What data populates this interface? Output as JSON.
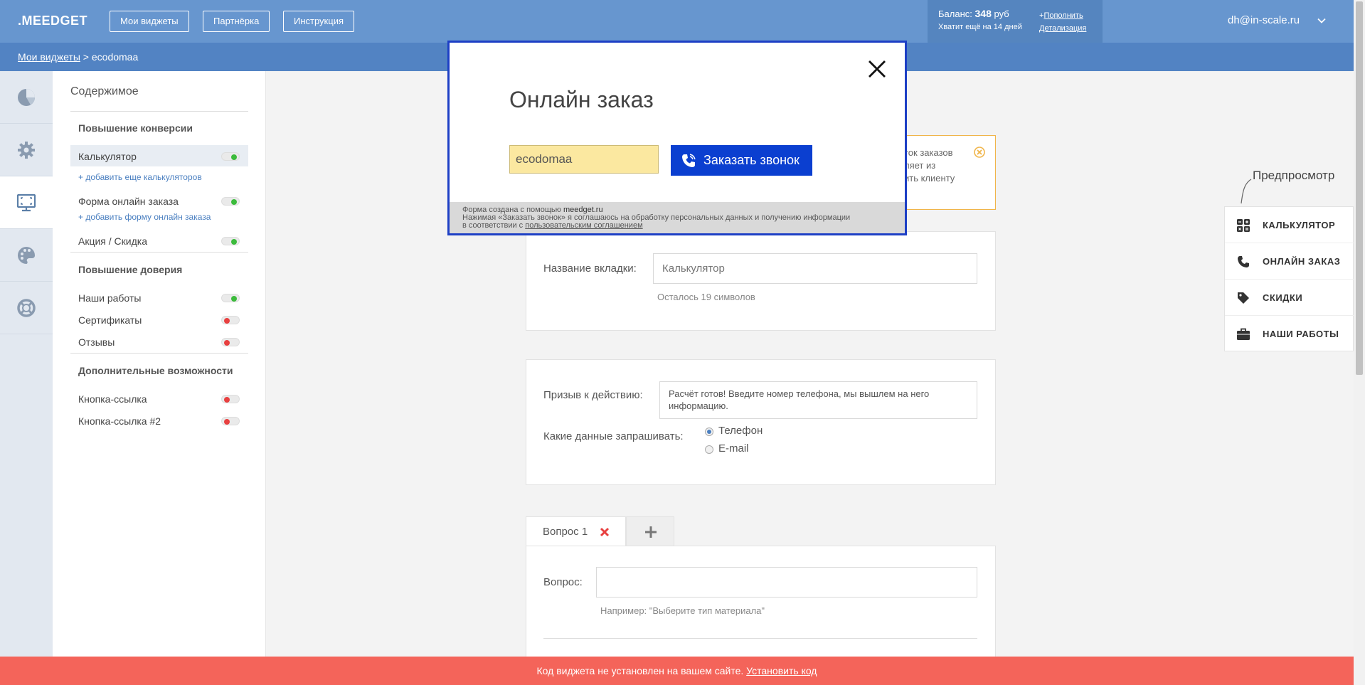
{
  "header": {
    "logo": ".MEEDGET",
    "nav": [
      "Мои виджеты",
      "Партнёрка",
      "Инструкция"
    ],
    "balance_label": "Баланс:",
    "balance_value": "348",
    "balance_currency": "руб",
    "balance_days": "Хватит ещё на 14 дней",
    "topup_plus": "+",
    "topup_label": "Пополнить",
    "details_label": "Детализация",
    "user_email": "dh@in-scale.ru"
  },
  "breadcrumb": {
    "root": "Мои виджеты",
    "sep": " > ",
    "current": "ecodomaa"
  },
  "sidebar": {
    "title": "Содержимое",
    "sections": [
      {
        "title": "Повышение конверсии",
        "items": [
          {
            "label": "Калькулятор",
            "on": true,
            "selected": true,
            "add": "+ добавить еще калькуляторов"
          },
          {
            "label": "Форма онлайн заказа",
            "on": true,
            "selected": false,
            "add": "+ добавить форму онлайн заказа"
          },
          {
            "label": "Акция / Скидка",
            "on": true,
            "selected": false,
            "add": ""
          }
        ]
      },
      {
        "title": "Повышение доверия",
        "items": [
          {
            "label": "Наши работы",
            "on": true
          },
          {
            "label": "Сертификаты",
            "on": false
          },
          {
            "label": "Отзывы",
            "on": false
          }
        ]
      },
      {
        "title": "Дополнительные возможности",
        "items": [
          {
            "label": "Кнопка-ссылка",
            "on": false
          },
          {
            "label": "Кнопка-ссылка #2",
            "on": false
          }
        ]
      }
    ]
  },
  "notice": {
    "line1": "ток заказов",
    "line2": "ляет из",
    "line3": "ить клиенту"
  },
  "tab_name": {
    "label": "Название вкладки:",
    "placeholder": "Калькулятор",
    "hint": "Осталось 19 символов"
  },
  "cta": {
    "label": "Призыв к действию:",
    "value": "Расчёт готов! Введите номер телефона, мы вышлем на него информацию.",
    "request_label": "Какие данные запрашивать:",
    "options": [
      "Телефон",
      "E-mail"
    ],
    "selected": "Телефон"
  },
  "questions": {
    "tab_label": "Вопрос 1",
    "question_label": "Вопрос:",
    "question_value": "",
    "hint": "Например: \"Выберите тип материала\""
  },
  "preview": {
    "title": "Предпросмотр",
    "items": [
      "КАЛЬКУЛЯТОР",
      "ОНЛАЙН ЗАКАЗ",
      "СКИДКИ",
      "НАШИ РАБОТЫ"
    ]
  },
  "modal": {
    "title": "Онлайн заказ",
    "input_value": "ecodomaa",
    "button_label": "Заказать звонок",
    "footer_line1_prefix": "Форма создана с помощью ",
    "footer_site": "meedget.ru",
    "footer_line2": "Нажимая «Заказать звонок» я соглашаюсь на обработку персональных данных и получению информации",
    "footer_line3_prefix": "в соответствии с ",
    "footer_link": "пользовательским соглашением"
  },
  "banner": {
    "text": "Код виджета не установлен на вашем сайте.",
    "link": "Установить код"
  },
  "colors": {
    "header": "#6796cf",
    "breadcrumb": "#5283c3",
    "modal_border": "#1d3fc5",
    "modal_button": "#0b3fd0",
    "banner": "#f4645a",
    "toggle_on": "#3cbb3c",
    "toggle_off": "#e84040"
  }
}
